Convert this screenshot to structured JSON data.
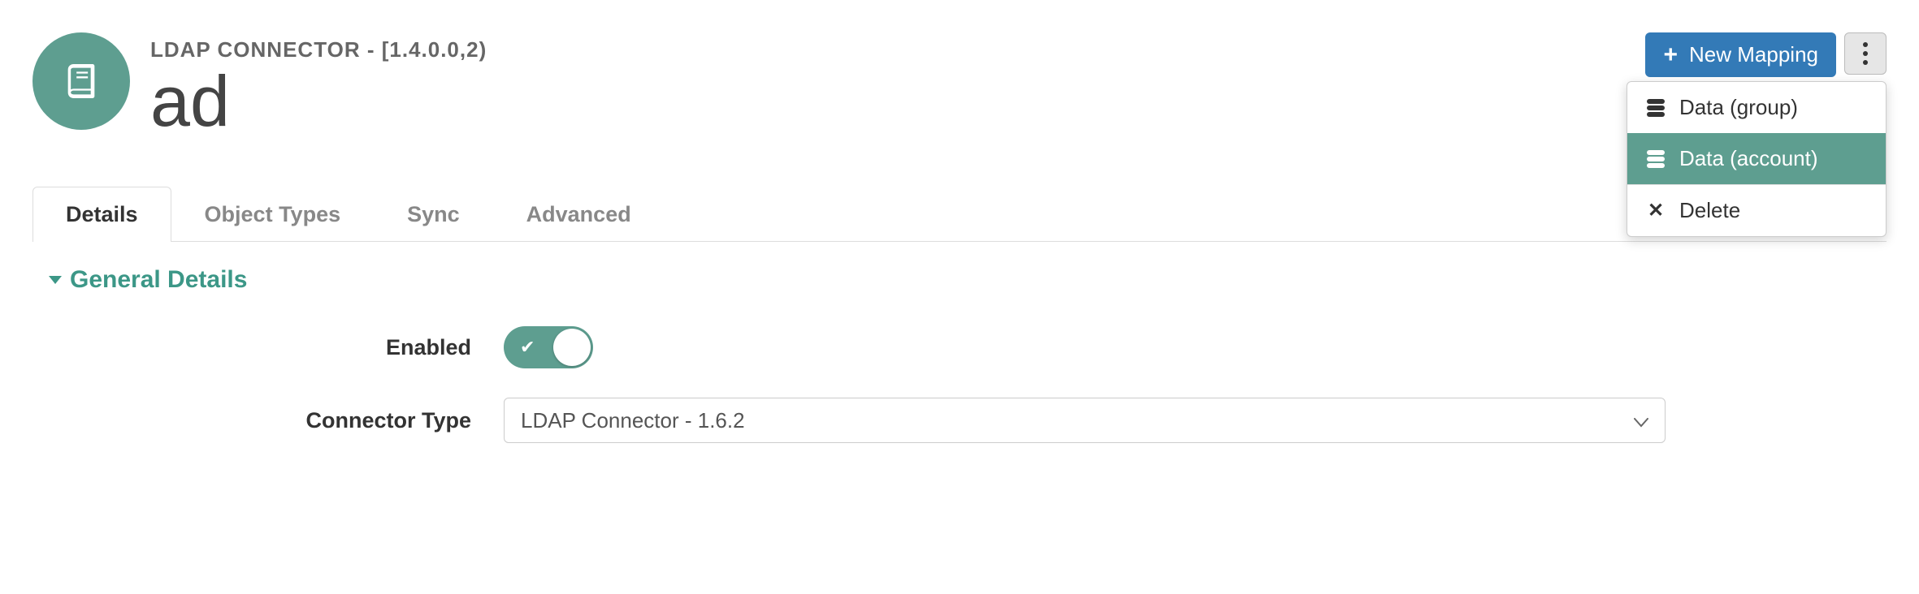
{
  "header": {
    "subtitle": "LDAP CONNECTOR - [1.4.0.0,2)",
    "title": "ad",
    "new_mapping_label": "New Mapping"
  },
  "dropdown": {
    "items": [
      {
        "label": "Data (group)",
        "icon": "database"
      },
      {
        "label": "Data (account)",
        "icon": "database",
        "highlight": true
      }
    ],
    "delete_label": "Delete"
  },
  "tabs": [
    {
      "label": "Details",
      "active": true
    },
    {
      "label": "Object Types",
      "active": false
    },
    {
      "label": "Sync",
      "active": false
    },
    {
      "label": "Advanced",
      "active": false
    }
  ],
  "section": {
    "title": "General Details"
  },
  "form": {
    "enabled_label": "Enabled",
    "enabled_value": true,
    "connector_type_label": "Connector Type",
    "connector_type_value": "LDAP Connector - 1.6.2"
  },
  "colors": {
    "accent_green": "#5e9e90",
    "accent_blue": "#337ab7"
  }
}
